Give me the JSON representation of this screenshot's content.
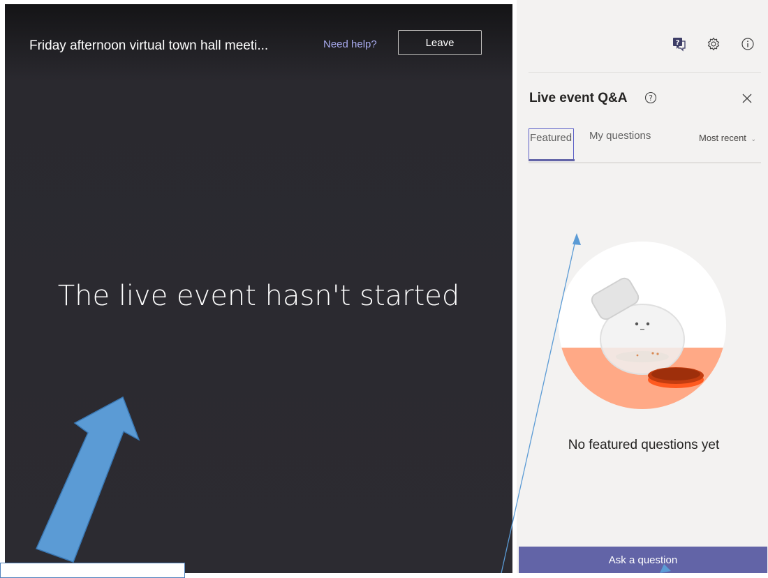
{
  "stage": {
    "title": "Friday afternoon virtual town hall meeti...",
    "help_link": "Need help?",
    "leave_label": "Leave",
    "status": "The live event hasn't started"
  },
  "panel": {
    "top_icons": [
      "qa-icon",
      "gear-icon",
      "info-icon"
    ],
    "title": "Live event Q&A",
    "tabs": [
      {
        "label": "Featured",
        "selected": true
      },
      {
        "label": "My questions",
        "selected": false
      }
    ],
    "sort_label": "Most recent",
    "empty_message": "No featured questions yet",
    "ask_label": "Ask a question"
  },
  "colors": {
    "accent": "#6264a7",
    "stage_bg": "#2c2b31",
    "panel_bg": "#f3f2f1",
    "annotation": "#5b9bd5"
  }
}
